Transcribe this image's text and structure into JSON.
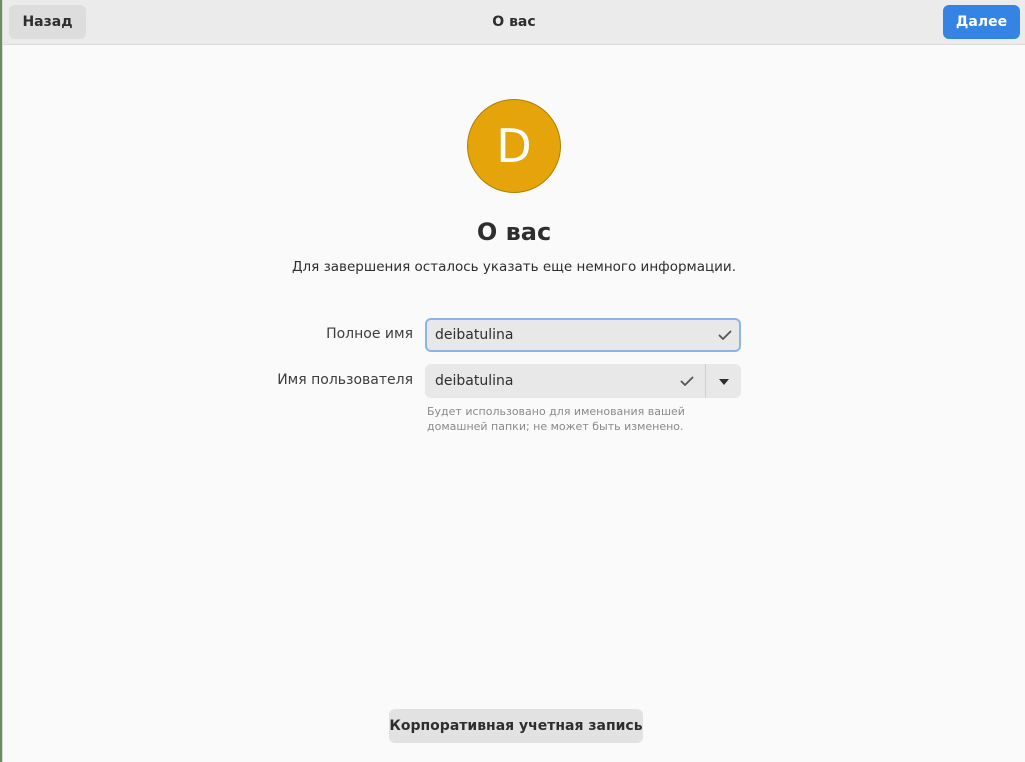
{
  "header": {
    "back_label": "Назад",
    "title": "О вас",
    "next_label": "Далее"
  },
  "avatar": {
    "initial": "D",
    "color": "#e5a50a"
  },
  "page": {
    "title": "О вас",
    "subtitle": "Для завершения осталось указать еще немного информации."
  },
  "form": {
    "fullname_label": "Полное имя",
    "fullname_value": "deibatulina",
    "username_label": "Имя пользователя",
    "username_value": "deibatulina",
    "username_hint": "Будет использовано для именования вашей домашней папки; не может быть изменено.",
    "valid_icon": "checkmark-icon",
    "dropdown_icon": "triangle-down-icon"
  },
  "footer": {
    "enterprise_label": "Корпоративная учетная запись"
  },
  "colors": {
    "accent": "#3584e4",
    "focus_border": "#8bb4e8"
  }
}
